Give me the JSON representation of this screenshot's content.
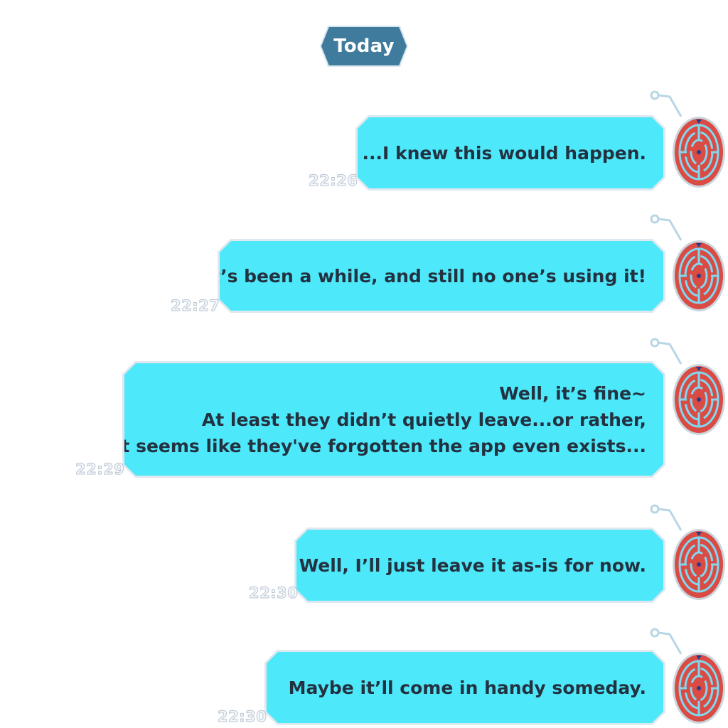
{
  "date_divider": {
    "label": "Today"
  },
  "colors": {
    "bubble": "#4ee8fb",
    "bubble_text": "#233240",
    "date_chip": "#3f7b9c",
    "avatar_ring": "#d94b43",
    "maze_lines": "#7fd8f0"
  },
  "messages": [
    {
      "lines": [
        "...I knew this would happen."
      ],
      "time": "22:26",
      "avatar_icon": "maze-avatar-icon"
    },
    {
      "lines": [
        "It’s been a while, and still no one’s using it!"
      ],
      "time": "22:27",
      "avatar_icon": "maze-avatar-icon"
    },
    {
      "lines": [
        "Well, it’s fine~",
        "At least they didn’t quietly leave...or rather,",
        "it seems like they've forgotten the app even exists..."
      ],
      "time": "22:29",
      "avatar_icon": "maze-avatar-icon"
    },
    {
      "lines": [
        "Well, I’ll just leave it as-is for now."
      ],
      "time": "22:30",
      "avatar_icon": "maze-avatar-icon"
    },
    {
      "lines": [
        "Maybe it’ll come in handy someday."
      ],
      "time": "22:30",
      "avatar_icon": "maze-avatar-icon"
    }
  ]
}
